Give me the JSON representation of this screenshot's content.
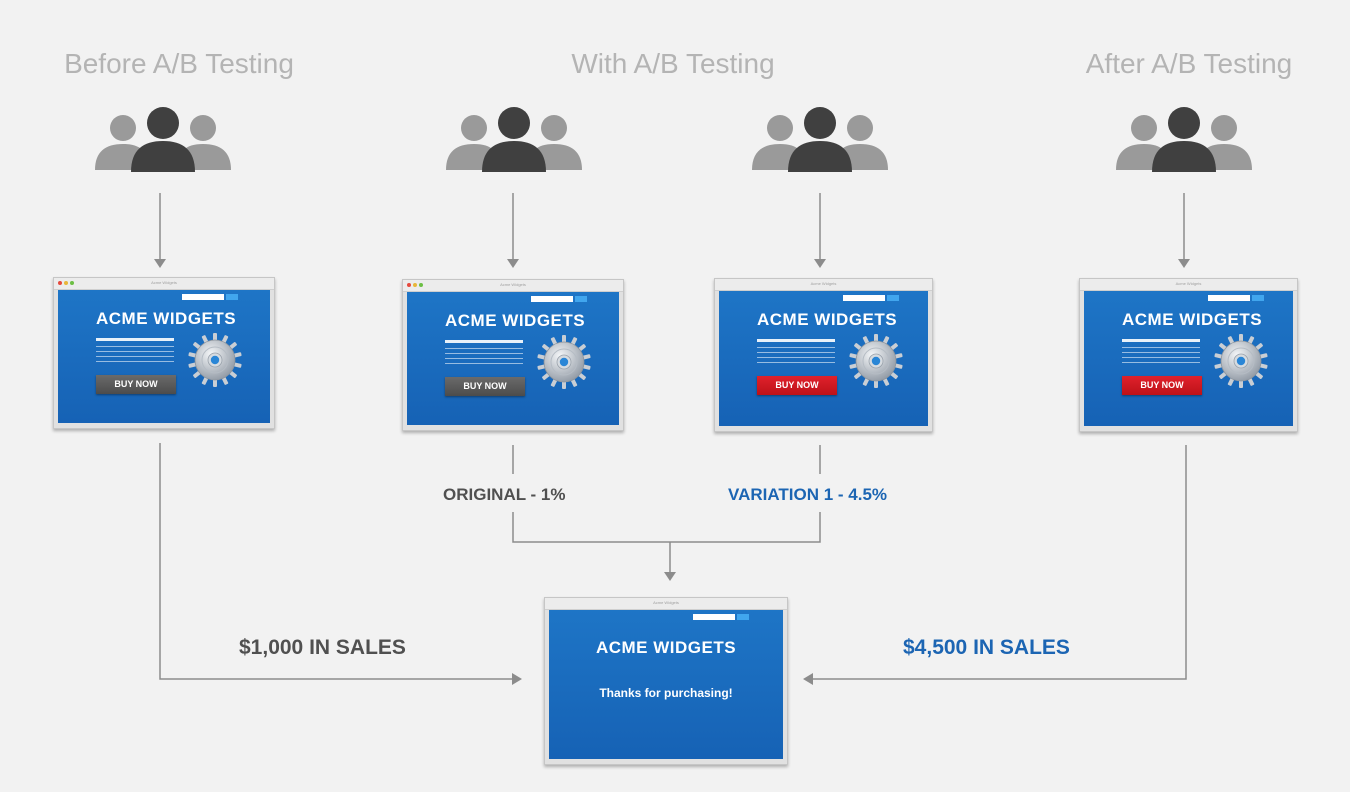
{
  "headings": {
    "before": "Before A/B Testing",
    "with": "With A/B Testing",
    "after": "After A/B Testing"
  },
  "browser": {
    "tiny_title": "Acme Widgets",
    "brand": "ACME WIDGETS",
    "buy_label": "BUY NOW",
    "thanks": "Thanks for purchasing!"
  },
  "results": {
    "original": "ORIGINAL - 1%",
    "variation": "VARIATION 1 - 4.5%"
  },
  "sales": {
    "before": "$1,000 IN SALES",
    "after": "$4,500 IN SALES"
  },
  "colors": {
    "heading": "#b4b4b4",
    "neutral_text": "#505050",
    "accent_blue": "#1c65b3",
    "screen_blue": "#1e75c6",
    "button_gray": "#5a5a5a",
    "button_red": "#d51a23",
    "connector": "#8c8c8c"
  },
  "icons": {
    "users": "user-group-icon",
    "gear": "gear-icon"
  }
}
